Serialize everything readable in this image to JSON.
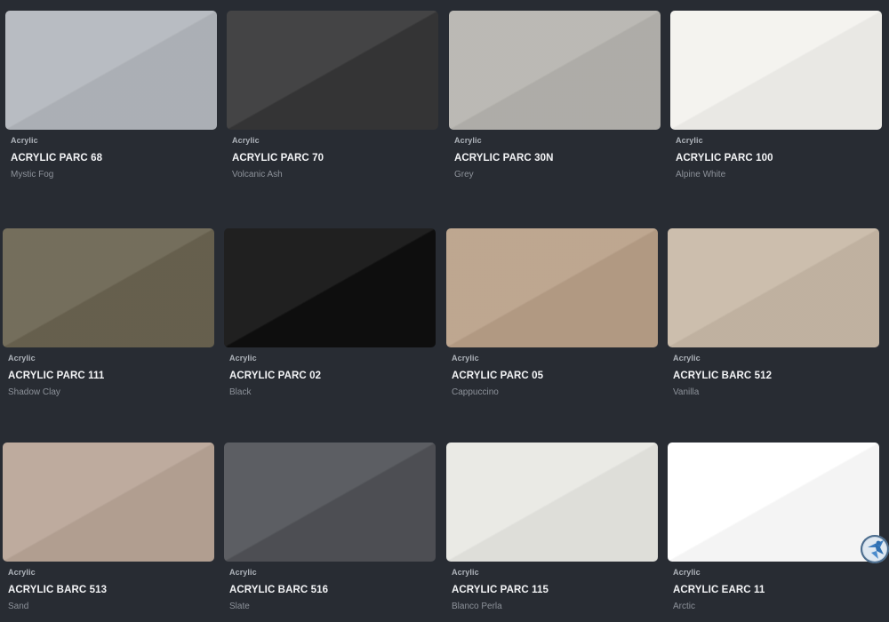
{
  "products": [
    {
      "category": "Acrylic",
      "name": "ACRYLIC PARC 68",
      "color_name": "Mystic Fog",
      "swatch": "#b3b7bd"
    },
    {
      "category": "Acrylic",
      "name": "ACRYLIC PARC 70",
      "color_name": "Volcanic Ash",
      "swatch": "#363637"
    },
    {
      "category": "Acrylic",
      "name": "ACRYLIC PARC 30N",
      "color_name": "Grey",
      "swatch": "#b6b4af"
    },
    {
      "category": "Acrylic",
      "name": "ACRYLIC PARC 100",
      "color_name": "Alpine White",
      "swatch": "#f3f2ee"
    },
    {
      "category": "Acrylic",
      "name": "ACRYLIC PARC 111",
      "color_name": "Shadow Clay",
      "swatch": "#6a6350"
    },
    {
      "category": "Acrylic",
      "name": "ACRYLIC PARC 02",
      "color_name": "Black",
      "swatch": "#0f0f0f"
    },
    {
      "category": "Acrylic",
      "name": "ACRYLIC PARC 05",
      "color_name": "Cappuccino",
      "swatch": "#b9a088"
    },
    {
      "category": "Acrylic",
      "name": "ACRYLIC BARC 512",
      "color_name": "Vanilla",
      "swatch": "#c8b9a7"
    },
    {
      "category": "Acrylic",
      "name": "ACRYLIC BARC 513",
      "color_name": "Sand",
      "swatch": "#b9a597"
    },
    {
      "category": "Acrylic",
      "name": "ACRYLIC BARC 516",
      "color_name": "Slate",
      "swatch": "#505257"
    },
    {
      "category": "Acrylic",
      "name": "ACRYLIC PARC 115",
      "color_name": "Blanco Perla",
      "swatch": "#e8e8e3"
    },
    {
      "category": "Acrylic",
      "name": "ACRYLIC EARC 11",
      "color_name": "Arctic",
      "swatch": "#ffffff"
    }
  ],
  "floating_button": {
    "icon": "accessibility-icon",
    "color": "#2f6fb0"
  }
}
